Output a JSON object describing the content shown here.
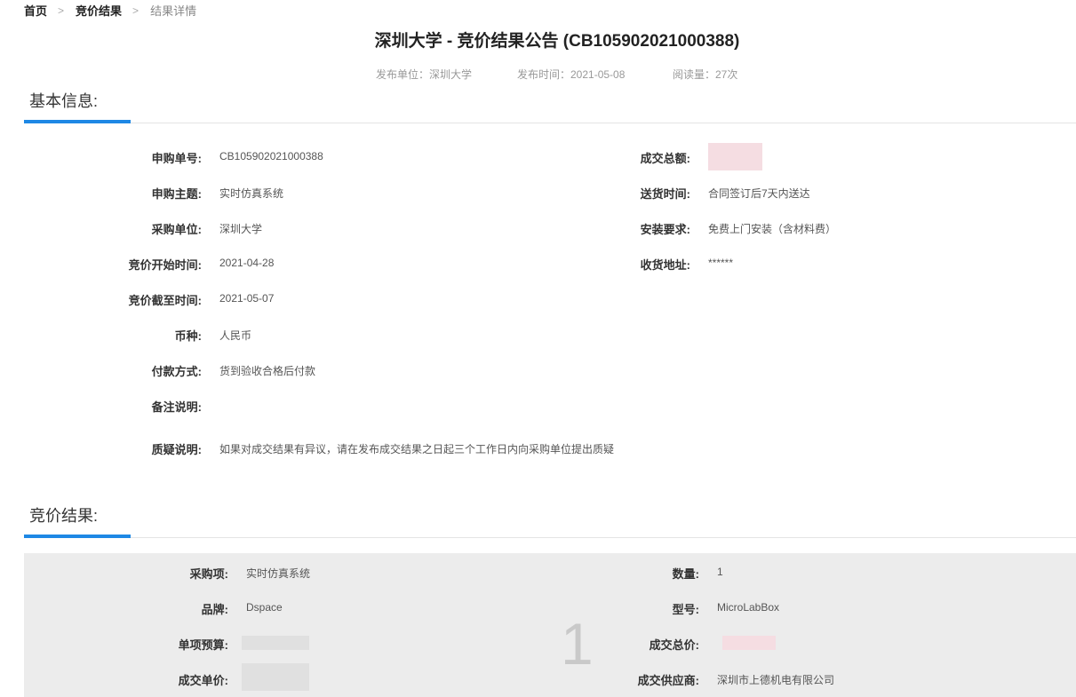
{
  "breadcrumb": {
    "home": "首页",
    "result": "竞价结果",
    "current": "结果详情",
    "separator": ">"
  },
  "page": {
    "title": "深圳大学 - 竞价结果公告 (CB105902021000388)",
    "publisher": "发布单位：深圳大学",
    "publish_time": "发布时间：2021-05-08",
    "views": "阅读量：27次"
  },
  "basic_info": {
    "section_title": "基本信息:",
    "left": [
      {
        "label": "申购单号:",
        "value": "CB105902021000388"
      },
      {
        "label": "申购主题:",
        "value": "实时仿真系统"
      },
      {
        "label": "采购单位:",
        "value": "深圳大学"
      },
      {
        "label": "竞价开始时间:",
        "value": "2021-04-28"
      },
      {
        "label": "竞价截至时间:",
        "value": "2021-05-07"
      },
      {
        "label": "币种:",
        "value": "人民币"
      },
      {
        "label": "付款方式:",
        "value": "货到验收合格后付款"
      },
      {
        "label": "备注说明:",
        "value": ""
      },
      {
        "label": "质疑说明:",
        "value": "如果对成交结果有异议，请在发布成交结果之日起三个工作日内向采购单位提出质疑"
      }
    ],
    "right": [
      {
        "label": "成交总额:",
        "value": ""
      },
      {
        "label": "送货时间:",
        "value": "合同签订后7天内送达"
      },
      {
        "label": "安装要求:",
        "value": "免费上门安装（含材料费）"
      },
      {
        "label": "收货地址:",
        "value": "******"
      }
    ]
  },
  "bid_result": {
    "section_title": "竞价结果:",
    "index": "1",
    "left": [
      {
        "label": "采购项:",
        "value": "实时仿真系统"
      },
      {
        "label": "品牌:",
        "value": "Dspace"
      },
      {
        "label": "单项预算:",
        "value": ""
      },
      {
        "label": "成交单价:",
        "value": ""
      }
    ],
    "right": [
      {
        "label": "数量:",
        "value": "1"
      },
      {
        "label": "型号:",
        "value": "MicroLabBox"
      },
      {
        "label": "成交总价:",
        "value": ""
      },
      {
        "label": "成交供应商:",
        "value": "深圳市上德机电有限公司"
      }
    ]
  }
}
